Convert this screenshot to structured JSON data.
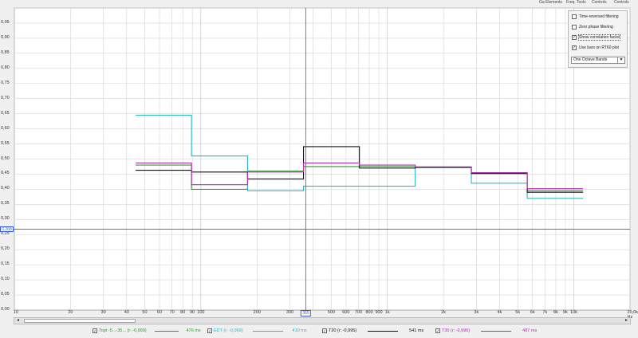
{
  "topbar": {
    "items": [
      "Ga Elements",
      "Freq. Tools",
      "Controls",
      "Controls"
    ]
  },
  "plot": {
    "y_ticks": [
      "0,95",
      "0,90",
      "0,85",
      "0,80",
      "0,75",
      "0,70",
      "0,65",
      "0,60",
      "0,55",
      "0,50",
      "0,45",
      "0,40",
      "0,35",
      "0,30",
      "0,25",
      "0,20",
      "0,15",
      "0,10",
      "0,05",
      "0,00"
    ],
    "x_ticks": [
      {
        "f": 10,
        "label": "10"
      },
      {
        "f": 20,
        "label": "20"
      },
      {
        "f": 30,
        "label": "30"
      },
      {
        "f": 40,
        "label": "40"
      },
      {
        "f": 50,
        "label": "50"
      },
      {
        "f": 60,
        "label": "60"
      },
      {
        "f": 70,
        "label": "70"
      },
      {
        "f": 80,
        "label": "80"
      },
      {
        "f": 90,
        "label": "90"
      },
      {
        "f": 100,
        "label": "100"
      },
      {
        "f": 200,
        "label": "200"
      },
      {
        "f": 300,
        "label": "300"
      },
      {
        "f": 500,
        "label": "500"
      },
      {
        "f": 600,
        "label": "600"
      },
      {
        "f": 700,
        "label": "700"
      },
      {
        "f": 800,
        "label": "800"
      },
      {
        "f": 900,
        "label": "900"
      },
      {
        "f": 1000,
        "label": "1k"
      },
      {
        "f": 2000,
        "label": "2k"
      },
      {
        "f": 3000,
        "label": "3k"
      },
      {
        "f": 4000,
        "label": "4k"
      },
      {
        "f": 5000,
        "label": "5k"
      },
      {
        "f": 6000,
        "label": "6k"
      },
      {
        "f": 7000,
        "label": "7k"
      },
      {
        "f": 8000,
        "label": "8k"
      },
      {
        "f": 9000,
        "label": "9k"
      },
      {
        "f": 10000,
        "label": "10k"
      },
      {
        "f": 20000,
        "label": "20,0k Hz"
      }
    ],
    "cursor_y_label": "0,268",
    "cursor_x_label": "365",
    "cursor_x": 365,
    "cursor_y": 0.268
  },
  "chart_data": {
    "type": "line",
    "x_scale": "log",
    "xlim": [
      10,
      20000
    ],
    "ylim": [
      0,
      1
    ],
    "step": true,
    "bands": [
      44.7,
      89.1,
      178,
      355,
      708,
      1410,
      2820,
      5620,
      11200
    ],
    "series": [
      {
        "name": "Topt -5..-35 (r: -0,999)",
        "color": "#2e9a2e",
        "values": [
          0.48,
          0.4,
          0.46,
          0.475,
          0.475,
          0.473,
          0.453,
          0.395
        ]
      },
      {
        "name": "EDT (r: -0,969)",
        "color": "#2bb8c4",
        "values": [
          0.645,
          0.51,
          0.395,
          0.41,
          0.41,
          0.473,
          0.42,
          0.37
        ]
      },
      {
        "name": "T20 (r: -0,995)",
        "color": "#111111",
        "values": [
          0.463,
          0.457,
          0.434,
          0.541,
          0.47,
          0.472,
          0.452,
          0.39
        ]
      },
      {
        "name": "T30 (r: -0,996)",
        "color": "#b02fb0",
        "values": [
          0.487,
          0.415,
          0.457,
          0.487,
          0.48,
          0.474,
          0.455,
          0.402
        ]
      }
    ]
  },
  "legend": [
    {
      "label": "Topt -5...-35... (r: -0,999)",
      "value": "476 ms",
      "color": "#2e9a2e"
    },
    {
      "label": "EDT (r: -0,969)",
      "value": "410 ms",
      "color": "#2bb8c4"
    },
    {
      "label": "T20 (r: -0,995)",
      "value": "541 ms",
      "color": "#111111"
    },
    {
      "label": "T30 (r: -0,996)",
      "value": "487 ms",
      "color": "#b02fb0"
    }
  ],
  "options": {
    "time_reversed": {
      "label": "Time-reversed filtering",
      "checked": false
    },
    "zero_phase": {
      "label": "Zero phase filtering",
      "checked": false
    },
    "show_corr": {
      "label": "Show correlation factor",
      "checked": true
    },
    "use_bars": {
      "label": "Use bars on RT60 plot",
      "checked": true
    },
    "band_select": {
      "value": "One Octave Bands"
    }
  },
  "colors": {
    "grid": "#d4d4d4",
    "cursor": "#3b5bd6",
    "plot_bg": "#ffffff"
  }
}
